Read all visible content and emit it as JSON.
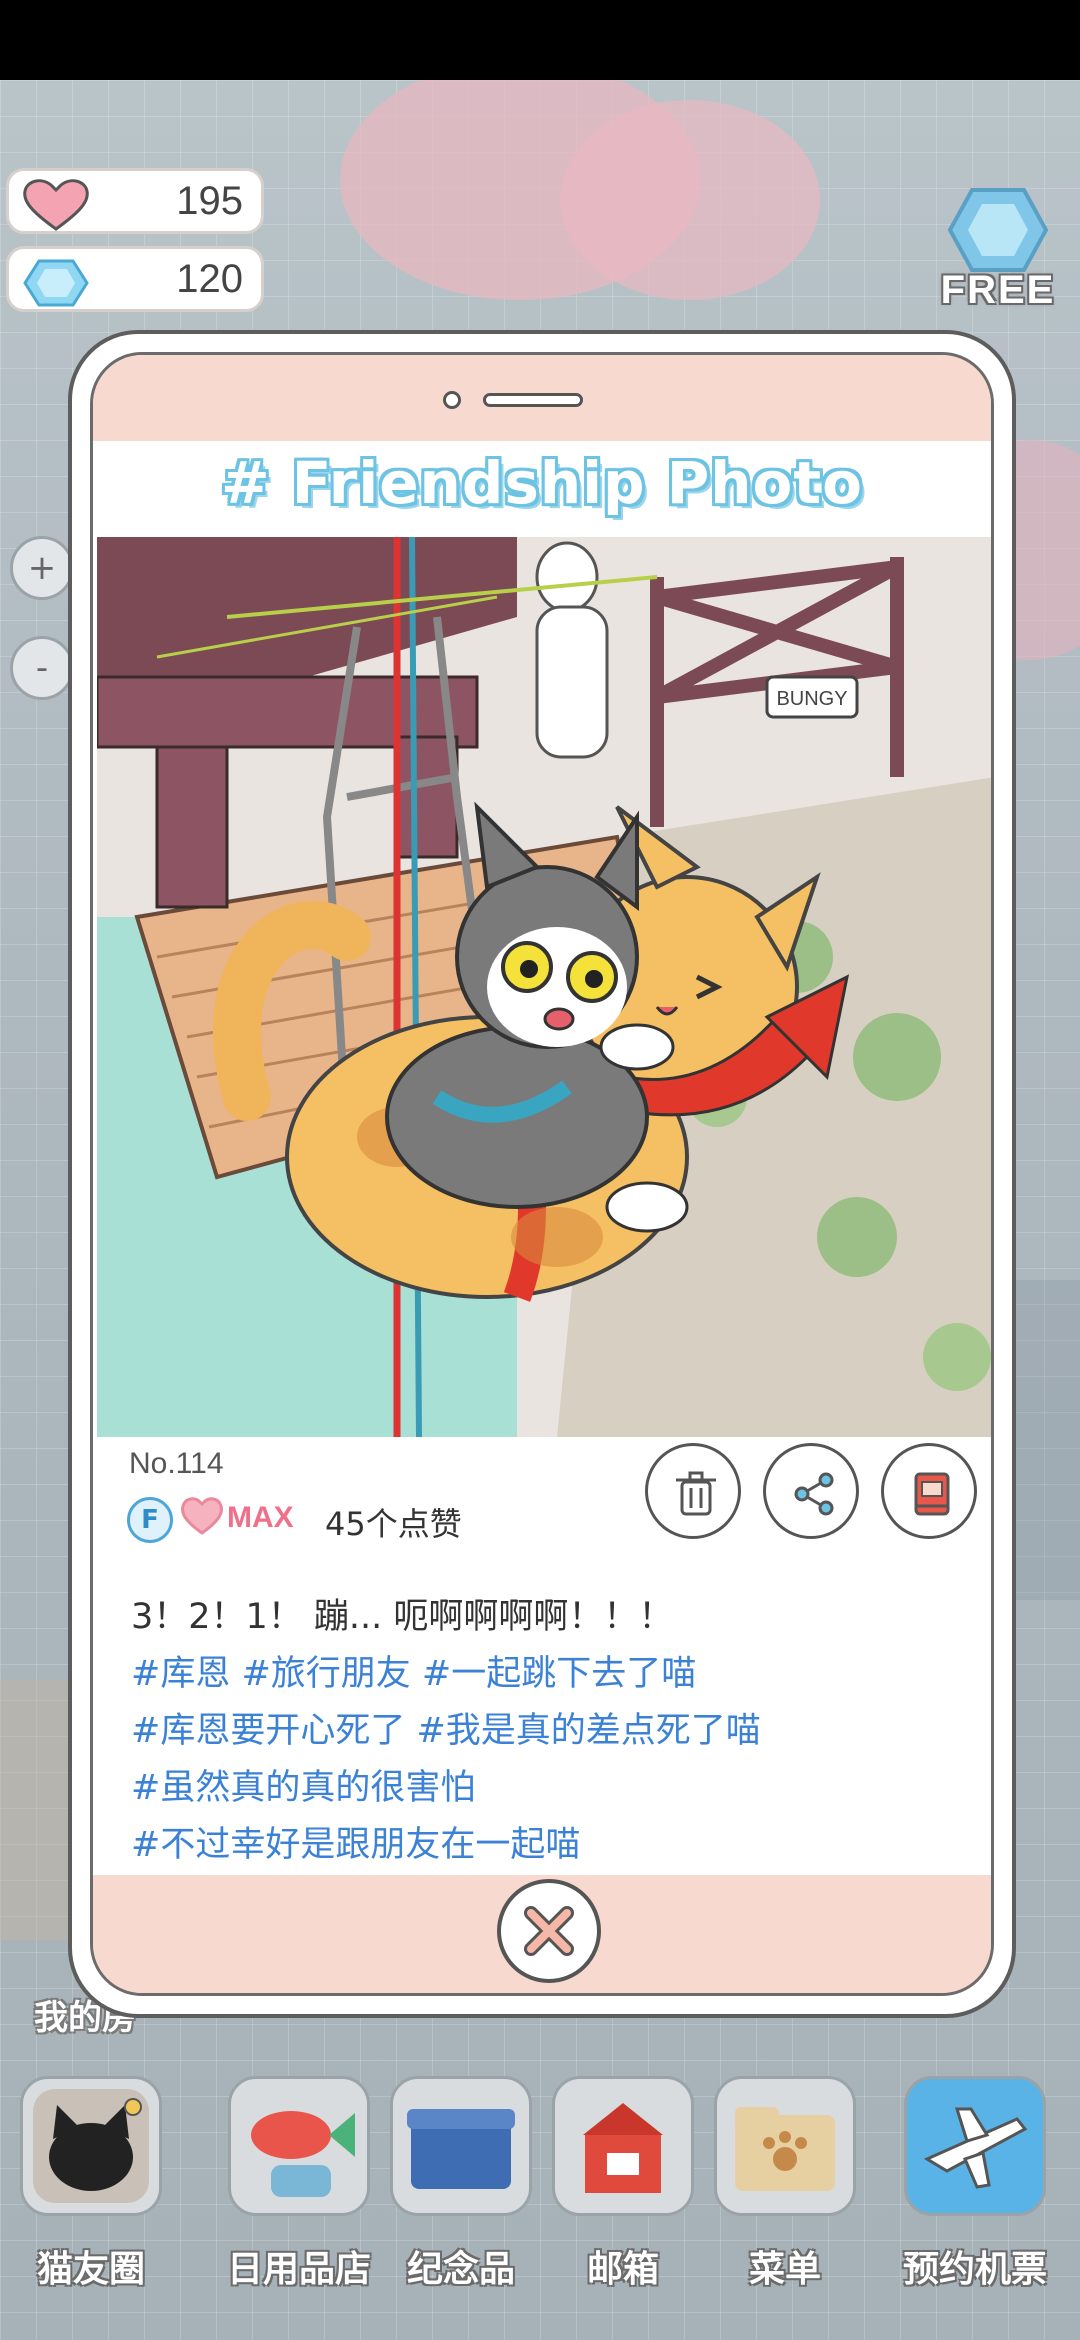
{
  "resources": {
    "hearts": "195",
    "gems": "120"
  },
  "free_label": "FREE",
  "side_buttons": {
    "zoom_in": "+",
    "zoom_out": "-"
  },
  "behind_label": "我的房",
  "modal": {
    "title": "# Friendship Photo",
    "photo_sign": "BUNGY",
    "number": "No.114",
    "friend_badge": "F",
    "max_label": "MAX",
    "likes": "45个点赞",
    "caption_first": "3！2！1！ 蹦... 呃啊啊啊啊！！！",
    "hashtag_lines": [
      "#库恩 #旅行朋友 #一起跳下去了喵",
      "#库恩要开心死了 #我是真的差点死了喵",
      "#虽然真的真的很害怕",
      "#不过幸好是跟朋友在一起喵"
    ]
  },
  "nav": [
    {
      "label": "猫友圈"
    },
    {
      "label": "日用品店"
    },
    {
      "label": "纪念品"
    },
    {
      "label": "邮箱"
    },
    {
      "label": "菜单"
    },
    {
      "label": "预约机票"
    }
  ],
  "colors": {
    "accent_blue": "#3b82d6",
    "peach": "#f7d9cf",
    "title_blue": "#6cc3e3",
    "heart_pink": "#f0708a"
  }
}
